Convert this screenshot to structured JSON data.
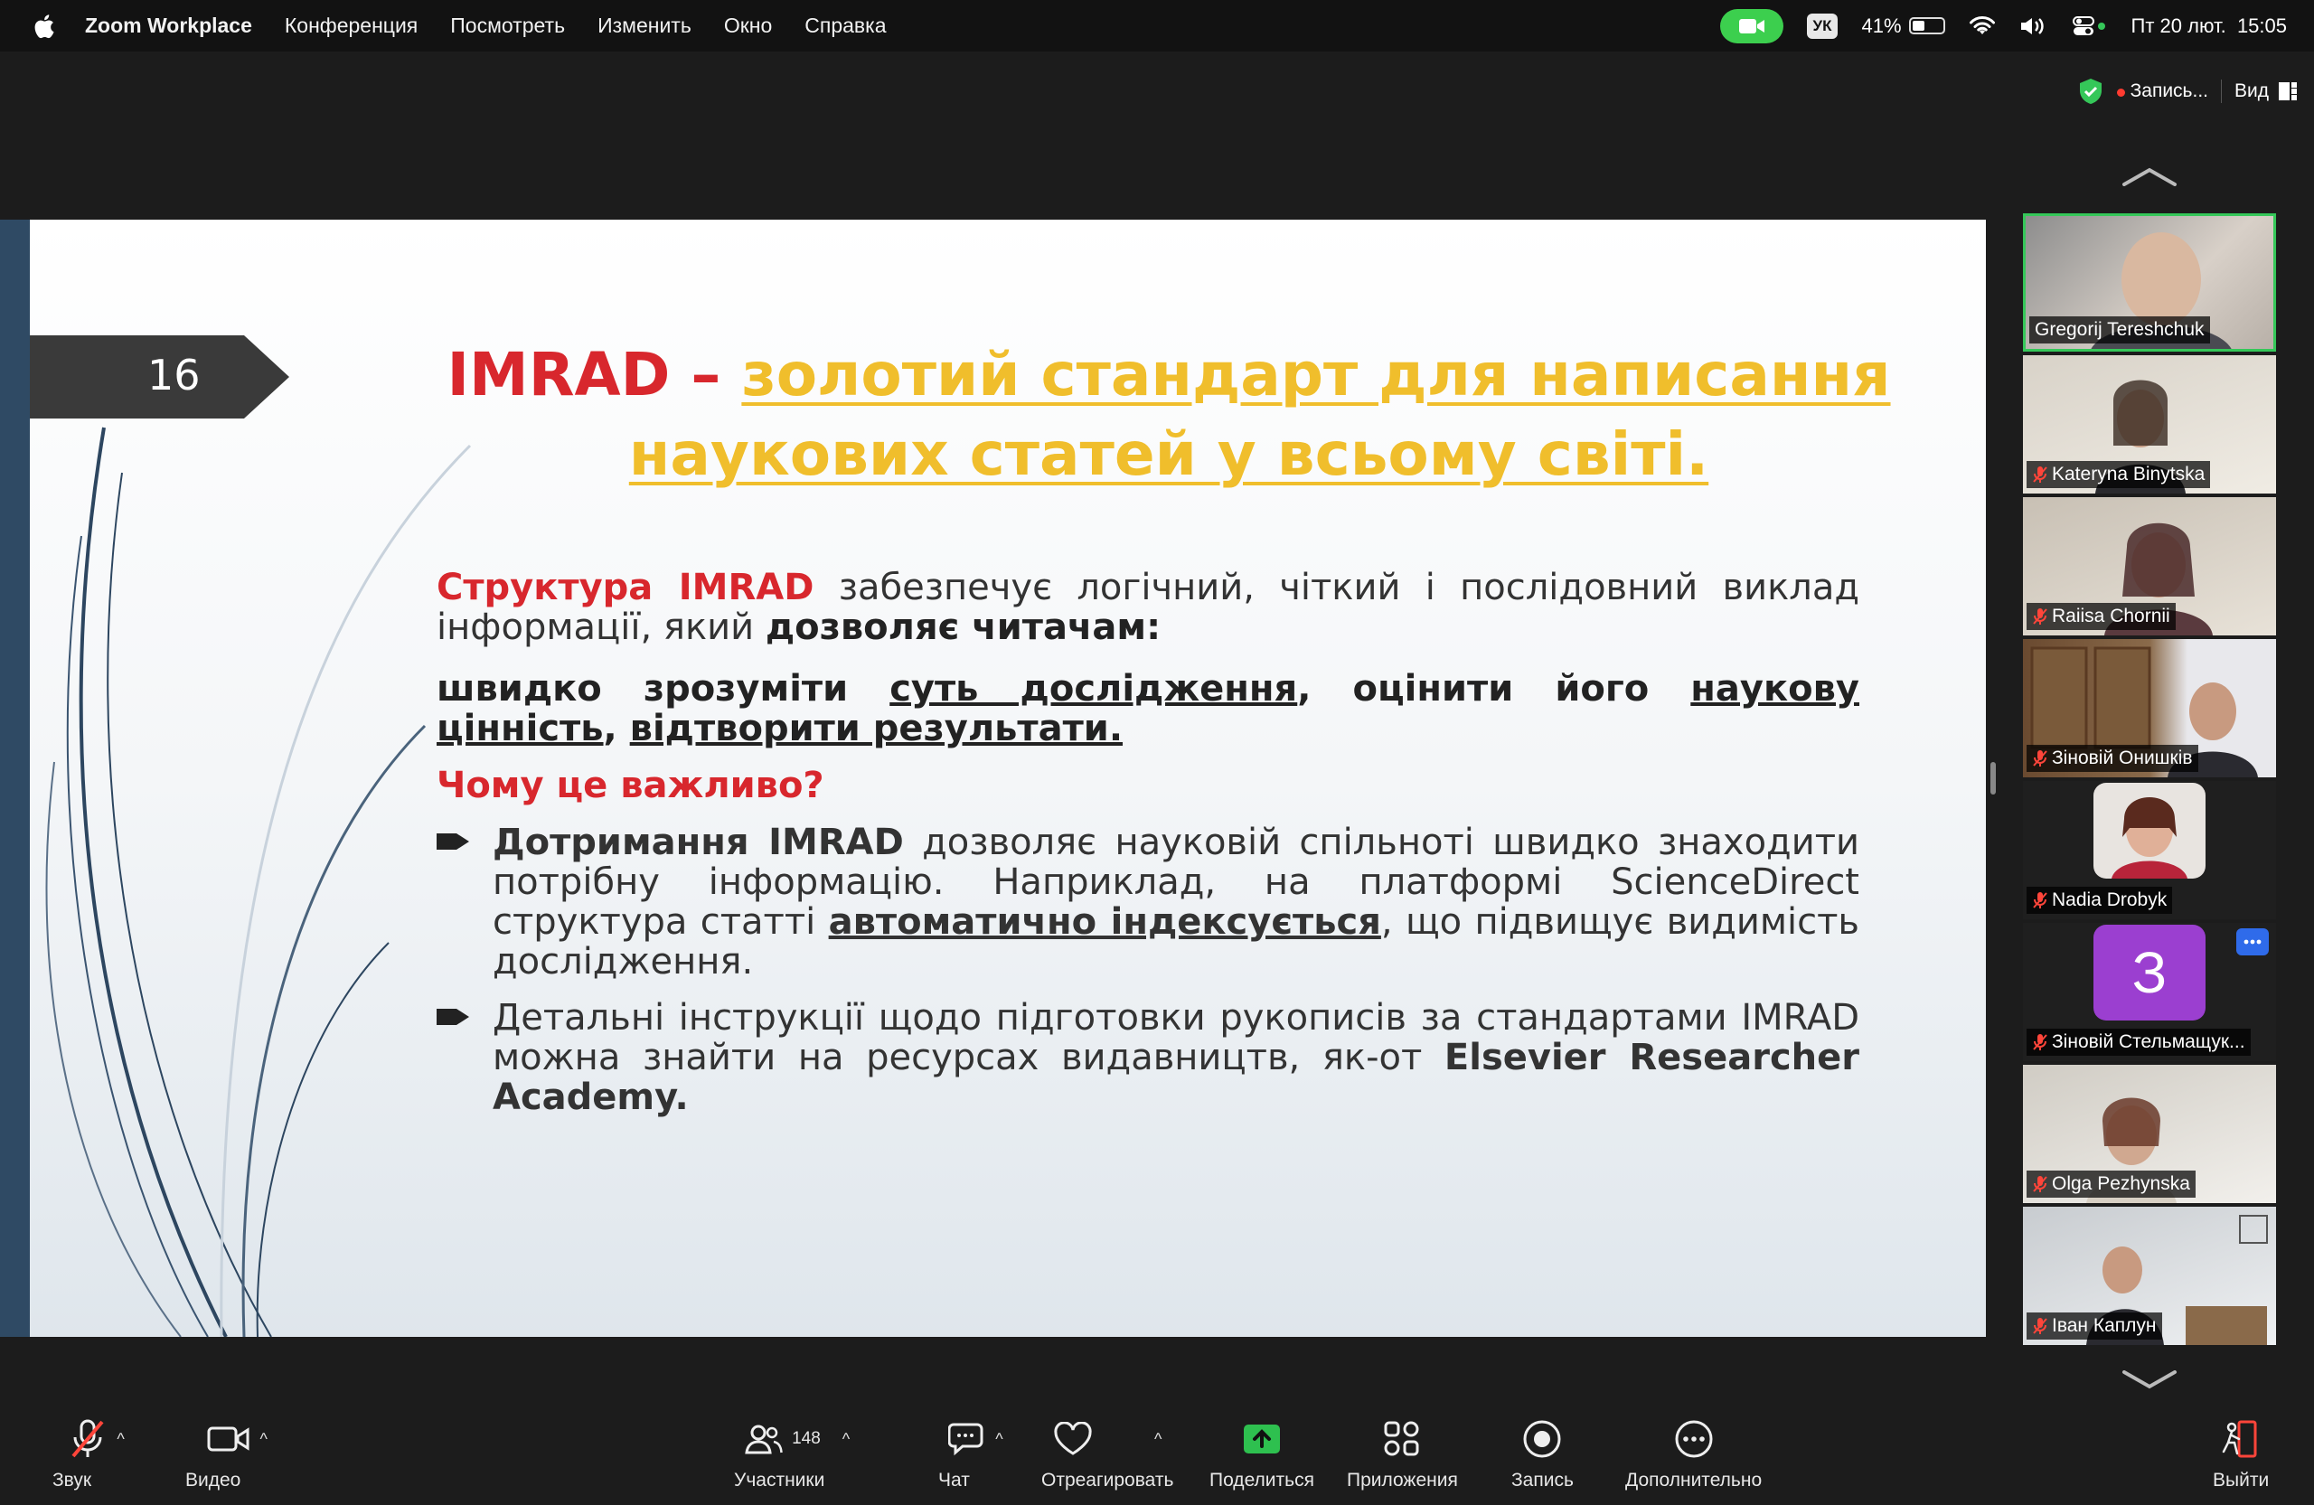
{
  "menubar": {
    "app_name": "Zoom Workplace",
    "items": [
      "Конференция",
      "Посмотреть",
      "Изменить",
      "Окно",
      "Справка"
    ],
    "keyboard_layout": "УК",
    "battery_percent": "41%",
    "battery_level": 0.41,
    "datetime": "Пт 20 лют.  15:05"
  },
  "zoom_top": {
    "recording_label": "Запись...",
    "view_label": "Вид"
  },
  "slide": {
    "number": "16",
    "title_red": "IMRAD – ",
    "title_gold": "золотий стандарт для написання наукових статей у всьому світі.",
    "p1_red": "Структура IMRAD",
    "p1_text": " забезпечує логічний, чіткий і послідовний виклад інформації, який ",
    "p1_bold": "дозволяє читачам:",
    "p2_a": "швидко зрозуміти ",
    "p2_u1": "суть дослідження",
    "p2_b": ", оцінити його ",
    "p2_u2": "наукову цінність",
    "p2_c": ", ",
    "p2_u3": "відтворити результати.",
    "heading": "Чому це важливо?",
    "b1_bold": "Дотримання IMRAD",
    "b1_text": " дозволяє науковій спільноті швидко знаходити потрібну інформацію. Наприклад, на платформі ScienceDirect структура статті ",
    "b1_u": "автоматично індексується",
    "b1_end": ", що підвищує видимість дослідження.",
    "b2_text": "Детальні інструкції щодо підготовки рукописів за стандартами IMRAD можна знайти на ресурсах видавництв, як-от ",
    "b2_bold": "Elsevier Researcher Academy."
  },
  "participants": [
    {
      "name": "Gregorij Tereshchuk",
      "muted": false,
      "active": true
    },
    {
      "name": "Kateryna Binytska",
      "muted": true
    },
    {
      "name": "Raiisa Chornii",
      "muted": true
    },
    {
      "name": "Зіновій Онишків",
      "muted": true
    },
    {
      "name": "Nadia Drobyk",
      "muted": true
    },
    {
      "name": "Зіновій Стельмащук...",
      "muted": true,
      "avatar_letter": "З"
    },
    {
      "name": "Olga Pezhynska",
      "muted": true
    },
    {
      "name": "Іван Каплун",
      "muted": true
    }
  ],
  "toolbar": {
    "audio": "Звук",
    "video": "Видео",
    "participants": "Участники",
    "participants_count": "148",
    "chat": "Чат",
    "react": "Отреагировать",
    "share": "Поделиться",
    "apps": "Приложения",
    "record": "Запись",
    "more": "Дополнительно",
    "leave": "Выйти"
  },
  "colors": {
    "accent_red": "#d8272d",
    "accent_gold": "#f0be2c",
    "active_green": "#35c759",
    "share_green": "#2ec04f",
    "zoom_blue": "#2f6bea"
  }
}
